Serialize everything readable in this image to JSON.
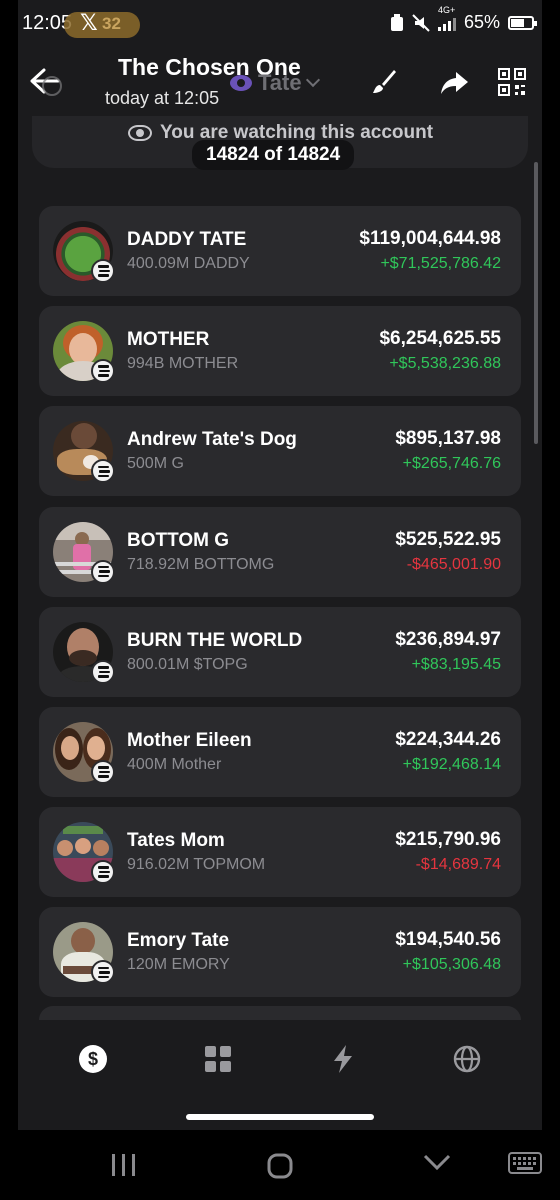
{
  "status_bar": {
    "time": "12:05",
    "notification_badge": "32",
    "network_type": "4G+",
    "battery_percent": "65%",
    "battery_level": 0.65
  },
  "header": {
    "title": "The Chosen One",
    "subtitle": "today at 12:05",
    "account_name": "Tate"
  },
  "watch_banner": {
    "text": "You are watching this account",
    "counter": "14824 of 14824"
  },
  "tokens": [
    {
      "name": "DADDY TATE",
      "amount": "400.09M DADDY",
      "value": "$119,004,644.98",
      "change": "+$71,525,786.42",
      "direction": "up"
    },
    {
      "name": "MOTHER",
      "amount": "994B MOTHER",
      "value": "$6,254,625.55",
      "change": "+$5,538,236.88",
      "direction": "up"
    },
    {
      "name": "Andrew Tate's Dog",
      "amount": "500M G",
      "value": "$895,137.98",
      "change": "+$265,746.76",
      "direction": "up"
    },
    {
      "name": "BOTTOM G",
      "amount": "718.92M BOTTOMG",
      "value": "$525,522.95",
      "change": "-$465,001.90",
      "direction": "down"
    },
    {
      "name": "BURN THE WORLD",
      "amount": "800.01M $TOPG",
      "value": "$236,894.97",
      "change": "+$83,195.45",
      "direction": "up"
    },
    {
      "name": "Mother Eileen",
      "amount": "400M Mother",
      "value": "$224,344.26",
      "change": "+$192,468.14",
      "direction": "up"
    },
    {
      "name": "Tates Mom",
      "amount": "916.02M TOPMOM",
      "value": "$215,790.96",
      "change": "-$14,689.74",
      "direction": "down"
    },
    {
      "name": "Emory Tate",
      "amount": "120M EMORY",
      "value": "$194,540.56",
      "change": "+$105,306.48",
      "direction": "up"
    }
  ],
  "colors": {
    "background": "#1b1b1d",
    "card": "#2a2a2d",
    "positive": "#30c65a",
    "negative": "#e5353f",
    "accent": "#6a52b8"
  },
  "tab_bar": {
    "tabs": [
      {
        "icon": "dollar-icon",
        "active": true
      },
      {
        "icon": "grid-icon",
        "active": false
      },
      {
        "icon": "lightning-icon",
        "active": false
      },
      {
        "icon": "globe-icon",
        "active": false
      }
    ]
  },
  "nav_bar": {
    "buttons": [
      "recents-icon",
      "home-icon",
      "back-chevron-icon",
      "keyboard-icon"
    ]
  }
}
